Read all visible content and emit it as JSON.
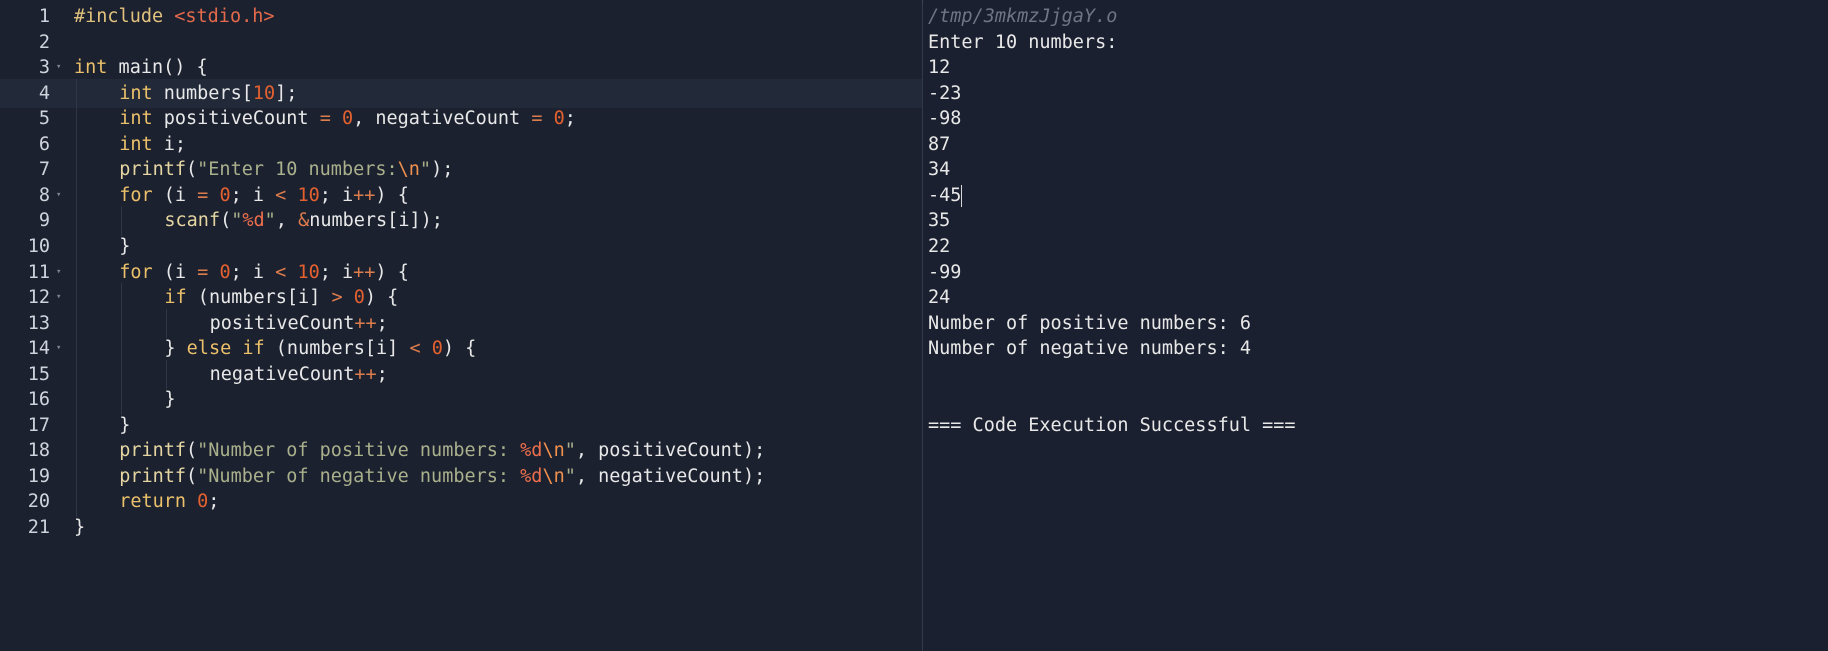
{
  "editor": {
    "language": "C",
    "active_line": 4,
    "lines": [
      {
        "num": "1",
        "fold": false,
        "indent": 0,
        "tokens": [
          [
            "pp",
            "#include"
          ],
          [
            "",
            " "
          ],
          [
            "hdr",
            "<stdio.h>"
          ]
        ]
      },
      {
        "num": "2",
        "fold": false,
        "indent": 0,
        "tokens": []
      },
      {
        "num": "3",
        "fold": true,
        "indent": 0,
        "tokens": [
          [
            "kw",
            "int"
          ],
          [
            "",
            " main() {"
          ]
        ]
      },
      {
        "num": "4",
        "fold": false,
        "indent": 1,
        "tokens": [
          [
            "kw",
            "int"
          ],
          [
            "",
            " numbers["
          ],
          [
            "num",
            "10"
          ],
          [
            "",
            "];"
          ]
        ]
      },
      {
        "num": "5",
        "fold": false,
        "indent": 1,
        "tokens": [
          [
            "kw",
            "int"
          ],
          [
            "",
            " positiveCount "
          ],
          [
            "op",
            "="
          ],
          [
            "",
            " "
          ],
          [
            "num",
            "0"
          ],
          [
            "",
            ", negativeCount "
          ],
          [
            "op",
            "="
          ],
          [
            "",
            " "
          ],
          [
            "num",
            "0"
          ],
          [
            "",
            ";"
          ]
        ]
      },
      {
        "num": "6",
        "fold": false,
        "indent": 1,
        "tokens": [
          [
            "kw",
            "int"
          ],
          [
            "",
            " i;"
          ]
        ]
      },
      {
        "num": "7",
        "fold": false,
        "indent": 1,
        "tokens": [
          [
            "fn",
            "printf"
          ],
          [
            "",
            "("
          ],
          [
            "str",
            "\"Enter 10 numbers:"
          ],
          [
            "esc",
            "\\n"
          ],
          [
            "str",
            "\""
          ],
          [
            "",
            ");"
          ]
        ]
      },
      {
        "num": "8",
        "fold": true,
        "indent": 1,
        "tokens": [
          [
            "kw",
            "for"
          ],
          [
            "",
            " (i "
          ],
          [
            "op",
            "="
          ],
          [
            "",
            " "
          ],
          [
            "num",
            "0"
          ],
          [
            "",
            "; i "
          ],
          [
            "op",
            "<"
          ],
          [
            "",
            " "
          ],
          [
            "num",
            "10"
          ],
          [
            "",
            "; i"
          ],
          [
            "op",
            "++"
          ],
          [
            "",
            ") {"
          ]
        ]
      },
      {
        "num": "9",
        "fold": false,
        "indent": 2,
        "tokens": [
          [
            "fn",
            "scanf"
          ],
          [
            "",
            "("
          ],
          [
            "str",
            "\""
          ],
          [
            "fmt",
            "%d"
          ],
          [
            "str",
            "\""
          ],
          [
            "",
            ", "
          ],
          [
            "op",
            "&"
          ],
          [
            "",
            "numbers[i]);"
          ]
        ]
      },
      {
        "num": "10",
        "fold": false,
        "indent": 1,
        "tokens": [
          [
            "",
            "}"
          ]
        ]
      },
      {
        "num": "11",
        "fold": true,
        "indent": 1,
        "tokens": [
          [
            "kw",
            "for"
          ],
          [
            "",
            " (i "
          ],
          [
            "op",
            "="
          ],
          [
            "",
            " "
          ],
          [
            "num",
            "0"
          ],
          [
            "",
            "; i "
          ],
          [
            "op",
            "<"
          ],
          [
            "",
            " "
          ],
          [
            "num",
            "10"
          ],
          [
            "",
            "; i"
          ],
          [
            "op",
            "++"
          ],
          [
            "",
            ") {"
          ]
        ]
      },
      {
        "num": "12",
        "fold": true,
        "indent": 2,
        "tokens": [
          [
            "kw",
            "if"
          ],
          [
            "",
            " (numbers[i] "
          ],
          [
            "op",
            ">"
          ],
          [
            "",
            " "
          ],
          [
            "num",
            "0"
          ],
          [
            "",
            ") {"
          ]
        ]
      },
      {
        "num": "13",
        "fold": false,
        "indent": 3,
        "tokens": [
          [
            "",
            "positiveCount"
          ],
          [
            "op",
            "++"
          ],
          [
            "",
            ";"
          ]
        ]
      },
      {
        "num": "14",
        "fold": true,
        "indent": 2,
        "tokens": [
          [
            "",
            "} "
          ],
          [
            "kw",
            "else"
          ],
          [
            "",
            " "
          ],
          [
            "kw",
            "if"
          ],
          [
            "",
            " (numbers[i] "
          ],
          [
            "op",
            "<"
          ],
          [
            "",
            " "
          ],
          [
            "num",
            "0"
          ],
          [
            "",
            ") {"
          ]
        ]
      },
      {
        "num": "15",
        "fold": false,
        "indent": 3,
        "tokens": [
          [
            "",
            "negativeCount"
          ],
          [
            "op",
            "++"
          ],
          [
            "",
            ";"
          ]
        ]
      },
      {
        "num": "16",
        "fold": false,
        "indent": 2,
        "tokens": [
          [
            "",
            "}"
          ]
        ]
      },
      {
        "num": "17",
        "fold": false,
        "indent": 1,
        "tokens": [
          [
            "",
            "}"
          ]
        ]
      },
      {
        "num": "18",
        "fold": false,
        "indent": 1,
        "tokens": [
          [
            "fn",
            "printf"
          ],
          [
            "",
            "("
          ],
          [
            "str",
            "\"Number of positive numbers: "
          ],
          [
            "fmt",
            "%d"
          ],
          [
            "esc",
            "\\n"
          ],
          [
            "str",
            "\""
          ],
          [
            "",
            ", positiveCount);"
          ]
        ]
      },
      {
        "num": "19",
        "fold": false,
        "indent": 1,
        "tokens": [
          [
            "fn",
            "printf"
          ],
          [
            "",
            "("
          ],
          [
            "str",
            "\"Number of negative numbers: "
          ],
          [
            "fmt",
            "%d"
          ],
          [
            "esc",
            "\\n"
          ],
          [
            "str",
            "\""
          ],
          [
            "",
            ", negativeCount);"
          ]
        ]
      },
      {
        "num": "20",
        "fold": false,
        "indent": 1,
        "tokens": [
          [
            "kw",
            "return"
          ],
          [
            "",
            " "
          ],
          [
            "num",
            "0"
          ],
          [
            "",
            ";"
          ]
        ]
      },
      {
        "num": "21",
        "fold": false,
        "indent": 0,
        "tokens": [
          [
            "",
            "}"
          ]
        ]
      }
    ]
  },
  "output": {
    "path": "/tmp/3mkmzJjgaY.o",
    "caret_line": 7,
    "lines": [
      "Enter 10 numbers:",
      "12",
      "-23",
      "-98",
      "87",
      "34",
      "-45",
      "35",
      "22",
      "-99",
      "24",
      "Number of positive numbers: 6",
      "Number of negative numbers: 4",
      "",
      "",
      "=== Code Execution Successful ==="
    ]
  },
  "colors": {
    "background": "#1c2130",
    "keyword": "#ebc06a",
    "string": "#a9b08b",
    "number": "#e3602f",
    "header": "#e36a4a",
    "line_number": "#cfd3dc",
    "path": "#6f7584"
  }
}
